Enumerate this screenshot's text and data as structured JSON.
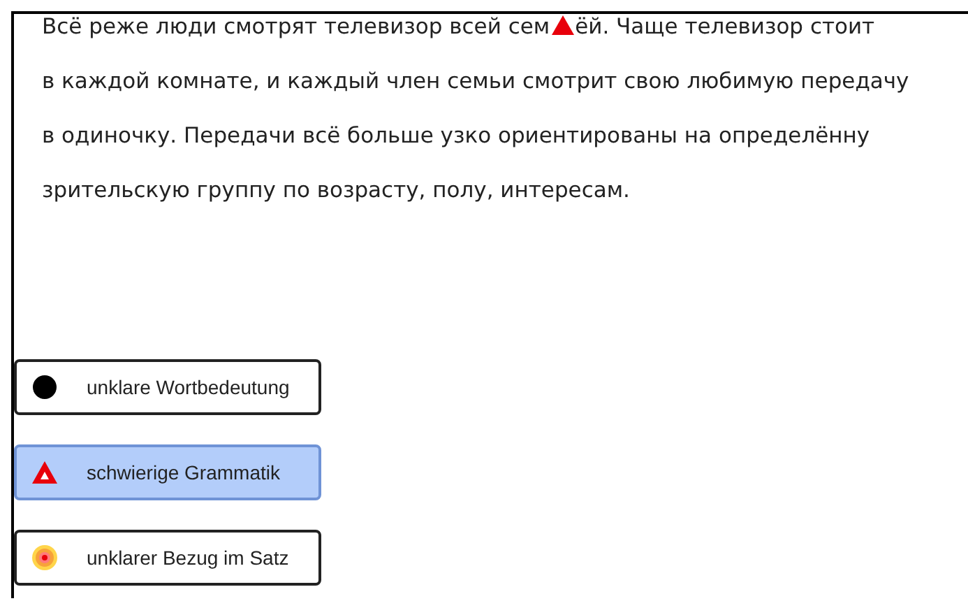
{
  "text_lines": [
    {
      "segments": [
        {
          "kind": "text",
          "text": "Всё реже люди смотрят телевизор всей сем"
        },
        {
          "kind": "triangle"
        },
        {
          "kind": "text",
          "text": "ёй. Чаще телевизор стоит"
        }
      ]
    },
    {
      "segments": [
        {
          "kind": "text",
          "text": "в каждой комнате, и каждый член семьи смотрит свою любимую передачу"
        }
      ]
    },
    {
      "segments": [
        {
          "kind": "text",
          "text": "в одиночку. Передачи всё больше узко ориентированы на определённу"
        }
      ]
    },
    {
      "segments": [
        {
          "kind": "text",
          "text": "зрительскую группу по возрасту, полу, интересам."
        }
      ]
    }
  ],
  "legend_buttons": [
    {
      "kind": "dot",
      "label": "unklare Wortbedeutung",
      "selected": false
    },
    {
      "kind": "triangle",
      "label": "schwierige Grammatik",
      "selected": true
    },
    {
      "kind": "target",
      "label": "unklarer Bezug im Satz",
      "selected": false
    }
  ]
}
